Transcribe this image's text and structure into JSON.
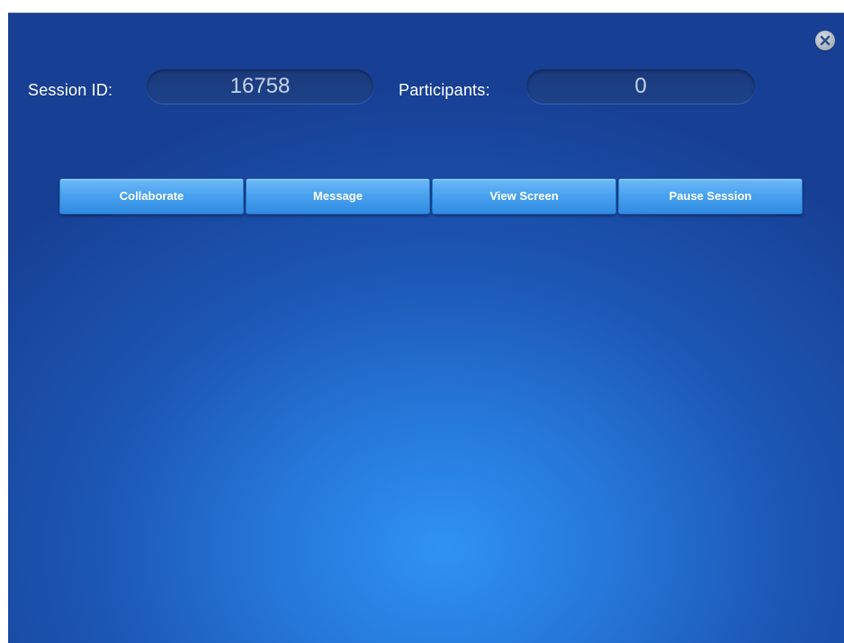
{
  "window": {
    "close_icon": "close-icon"
  },
  "session": {
    "label": "Session ID:",
    "value": "16758"
  },
  "participants": {
    "label": "Participants:",
    "value": "0"
  },
  "toolbar": {
    "buttons": [
      {
        "label": "Collaborate"
      },
      {
        "label": "Message"
      },
      {
        "label": "View Screen"
      },
      {
        "label": "Pause Session"
      }
    ]
  },
  "colors": {
    "background_top": "#173f93",
    "background_glow": "#2f93f2",
    "button": "#4ba3ef",
    "field": "#1b3a7d"
  }
}
